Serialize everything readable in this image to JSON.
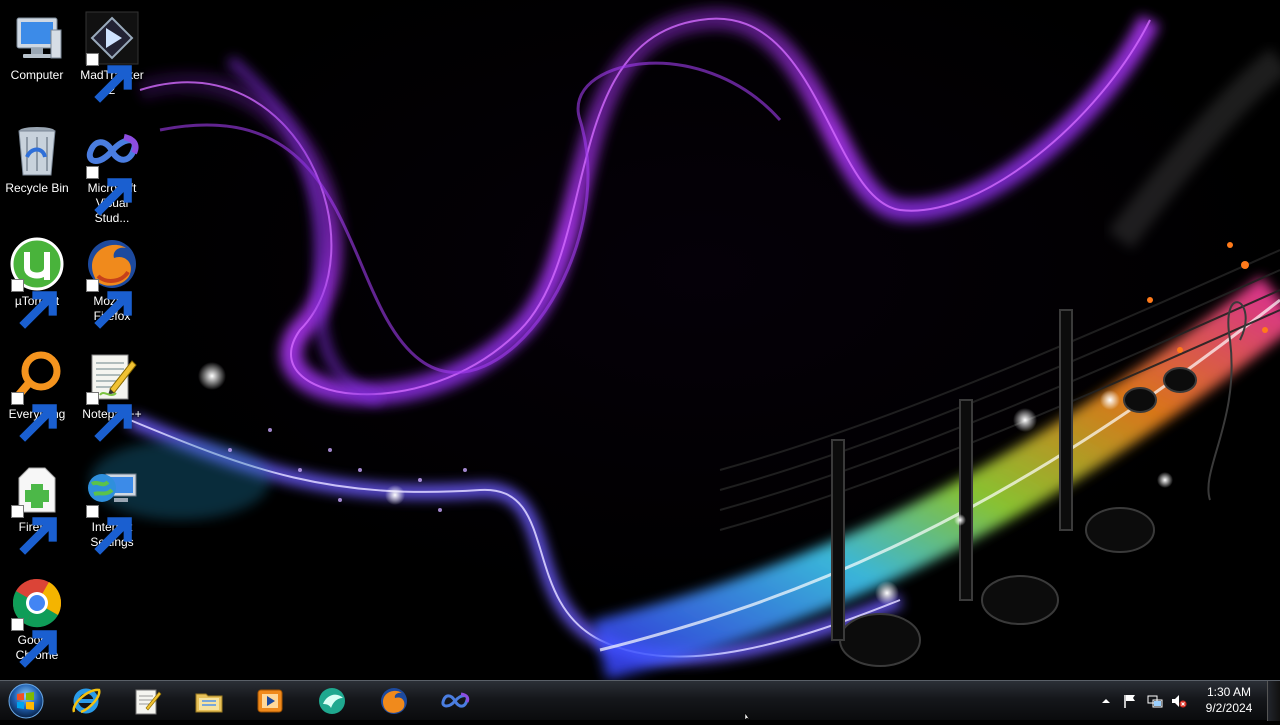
{
  "desktop": {
    "icons": [
      {
        "label": "Computer",
        "icon": "computer-icon"
      },
      {
        "label": "MadTracker 2",
        "icon": "madtracker-icon"
      },
      {
        "label": "Recycle Bin",
        "icon": "recycle-bin-icon"
      },
      {
        "label": "Microsoft Visual Stud...",
        "icon": "visual-studio-icon"
      },
      {
        "label": "µTorrent",
        "icon": "utorrent-icon"
      },
      {
        "label": "Mozilla Firefox",
        "icon": "firefox-icon"
      },
      {
        "label": "Everything",
        "icon": "everything-search-icon"
      },
      {
        "label": "Notepad++",
        "icon": "notepad-plus-plus-icon"
      },
      {
        "label": "Firefox",
        "icon": "firefox-installer-icon"
      },
      {
        "label": "Internet Settings",
        "icon": "internet-settings-icon"
      },
      {
        "label": "Google Chrome",
        "icon": "chrome-icon"
      }
    ]
  },
  "taskbar": {
    "pinned": [
      {
        "name": "Internet Explorer",
        "icon": "internet-explorer-icon"
      },
      {
        "name": "Notepad++",
        "icon": "notepad-icon"
      },
      {
        "name": "Windows Explorer",
        "icon": "folder-icon"
      },
      {
        "name": "Windows Media Player",
        "icon": "media-player-icon"
      },
      {
        "name": "Shark",
        "icon": "shark-icon"
      },
      {
        "name": "Mozilla Firefox",
        "icon": "firefox-icon"
      },
      {
        "name": "Visual Studio",
        "icon": "visual-studio-icon"
      }
    ]
  },
  "tray": {
    "time": "1:30 AM",
    "date": "9/2/2024",
    "icons": [
      "show-hidden-icons-chevron",
      "action-center-flag-icon",
      "network-icon",
      "volume-muted-icon"
    ]
  },
  "colors": {
    "accent_purple": "#9b30ff",
    "accent_pink": "#ff3fa0",
    "accent_orange": "#ff7a1a",
    "accent_cyan": "#4fd8ff",
    "accent_green": "#9be23a"
  }
}
